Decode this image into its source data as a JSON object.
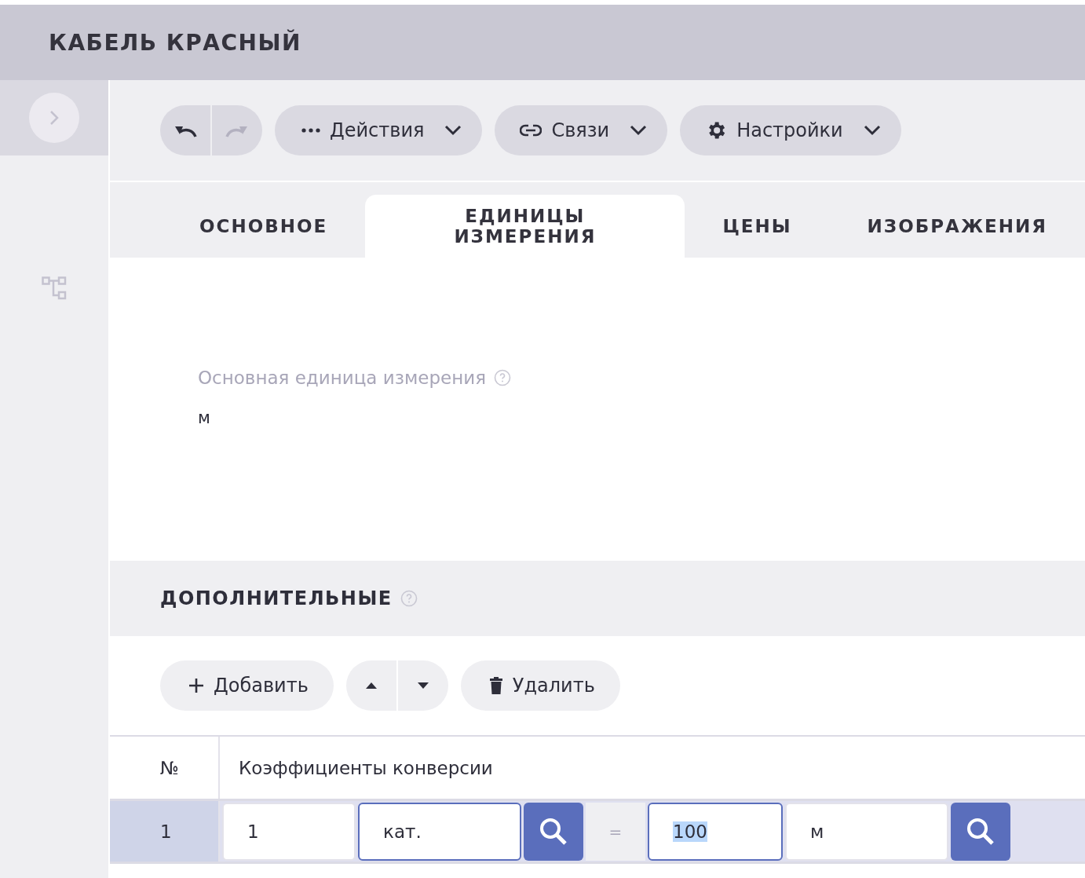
{
  "header": {
    "title": "КАБЕЛЬ КРАСНЫЙ"
  },
  "toolbar": {
    "history": [
      {
        "kind": "undo",
        "disabled": false
      },
      {
        "kind": "redo",
        "disabled": true
      }
    ],
    "menus": [
      {
        "kind": "dots",
        "label": "Действия"
      },
      {
        "kind": "link",
        "label": "Связи"
      },
      {
        "kind": "gear",
        "label": "Настройки"
      }
    ]
  },
  "tabs": [
    {
      "label": "ОСНОВНОЕ",
      "selected": false
    },
    {
      "label": "ЕДИНИЦЫ ИЗМЕРЕНИЯ",
      "selected": true
    },
    {
      "label": "ЦЕНЫ",
      "selected": false
    },
    {
      "label": "ИЗОБРАЖЕНИЯ",
      "selected": false
    }
  ],
  "base_unit": {
    "label": "Основная единица измерения",
    "value": "м"
  },
  "additional": {
    "title": "ДОПОЛНИТЕЛЬНЫЕ",
    "actions": [
      {
        "kind": "add",
        "label": "Добавить"
      },
      {
        "kind": "delete",
        "label": "Удалить"
      }
    ],
    "table": {
      "columns": [
        "№",
        "Коэффициенты конверсии"
      ],
      "rows": [
        {
          "number": "1",
          "selected": true,
          "left_amount": {
            "value": "1",
            "focused": false
          },
          "left_unit": {
            "value": "кат.",
            "focused": true
          },
          "equals": "=",
          "right_amount": {
            "value": "100",
            "focused": true,
            "text_selected": true
          },
          "right_unit": {
            "value": "м",
            "focused": false
          }
        }
      ]
    }
  }
}
